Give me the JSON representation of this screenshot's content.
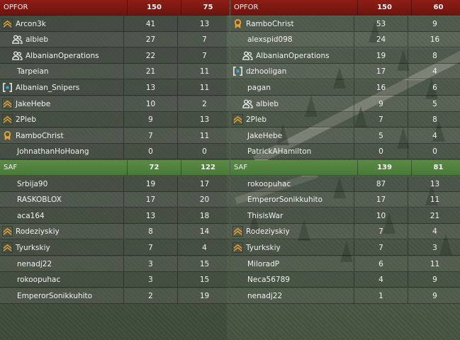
{
  "colors": {
    "opfor_header": "#7d1912",
    "saf_header": "#568640",
    "rank_orange": "#f0a030",
    "squad_blue": "#3aa8e8"
  },
  "left": {
    "opfor": {
      "team": "OPFOR",
      "a": "150",
      "b": "75"
    },
    "opfor_players": [
      {
        "icon": "rank-chevron-icon",
        "name": "Arcon3k",
        "a": "41",
        "b": "13"
      },
      {
        "icon": "friends-icon",
        "name": "albieb",
        "a": "27",
        "b": "7"
      },
      {
        "icon": "friends-icon",
        "name": "AlbanianOperations",
        "a": "22",
        "b": "7"
      },
      {
        "icon": "",
        "name": "Tarpeian",
        "a": "21",
        "b": "11"
      },
      {
        "icon": "squad-bracket-icon",
        "name": "Albanian_Snipers",
        "a": "13",
        "b": "11"
      },
      {
        "icon": "rank-chevron-icon",
        "name": "JakeHebe",
        "a": "10",
        "b": "2"
      },
      {
        "icon": "rank-chevron-icon",
        "name": "2Pleb",
        "a": "9",
        "b": "13"
      },
      {
        "icon": "rank-medal-icon",
        "name": "RamboChrist",
        "a": "7",
        "b": "11"
      },
      {
        "icon": "",
        "name": "JohnathanHoHoang",
        "a": "0",
        "b": "0"
      }
    ],
    "saf": {
      "team": "SAF",
      "a": "72",
      "b": "122"
    },
    "saf_players": [
      {
        "icon": "",
        "name": "Srbija90",
        "a": "19",
        "b": "17"
      },
      {
        "icon": "",
        "name": "RASKOBLOX",
        "a": "17",
        "b": "20"
      },
      {
        "icon": "",
        "name": "aca164",
        "a": "13",
        "b": "18"
      },
      {
        "icon": "rank-chevron-icon",
        "name": "Rodeziyskiy",
        "a": "8",
        "b": "14"
      },
      {
        "icon": "rank-chevron-icon",
        "name": "Tyurkskiy",
        "a": "7",
        "b": "4"
      },
      {
        "icon": "",
        "name": "nenadj22",
        "a": "3",
        "b": "15"
      },
      {
        "icon": "",
        "name": "rokoopuhac",
        "a": "3",
        "b": "15"
      },
      {
        "icon": "",
        "name": "EmperorSonikkuhito",
        "a": "2",
        "b": "19"
      }
    ]
  },
  "right": {
    "opfor": {
      "team": "OPFOR",
      "a": "150",
      "b": "60"
    },
    "opfor_players": [
      {
        "icon": "rank-medal-icon",
        "name": "RamboChrist",
        "a": "53",
        "b": "9"
      },
      {
        "icon": "",
        "name": "alexspid098",
        "a": "24",
        "b": "16"
      },
      {
        "icon": "friends-icon",
        "name": "AlbanianOperations",
        "a": "19",
        "b": "8"
      },
      {
        "icon": "squad-bracket-icon",
        "name": "dzhooligan",
        "a": "17",
        "b": "4"
      },
      {
        "icon": "",
        "name": "pagan",
        "a": "16",
        "b": "6"
      },
      {
        "icon": "friends-icon",
        "name": "albieb",
        "a": "9",
        "b": "5"
      },
      {
        "icon": "rank-chevron-icon",
        "name": "2Pleb",
        "a": "7",
        "b": "8"
      },
      {
        "icon": "",
        "name": "JakeHebe",
        "a": "5",
        "b": "4"
      },
      {
        "icon": "",
        "name": "PatrickAHamilton",
        "a": "0",
        "b": "0"
      }
    ],
    "saf": {
      "team": "SAF",
      "a": "139",
      "b": "81"
    },
    "saf_players": [
      {
        "icon": "",
        "name": "rokoopuhac",
        "a": "87",
        "b": "13"
      },
      {
        "icon": "",
        "name": "EmperorSonikkuhito",
        "a": "17",
        "b": "11"
      },
      {
        "icon": "",
        "name": "ThislsWar",
        "a": "10",
        "b": "21"
      },
      {
        "icon": "rank-chevron-icon",
        "name": "Rodeziyskiy",
        "a": "7",
        "b": "4"
      },
      {
        "icon": "rank-chevron-icon",
        "name": "Tyurkskiy",
        "a": "7",
        "b": "3"
      },
      {
        "icon": "",
        "name": "MiloradP",
        "a": "6",
        "b": "11"
      },
      {
        "icon": "",
        "name": "Neca56789",
        "a": "4",
        "b": "9"
      },
      {
        "icon": "",
        "name": "nenadj22",
        "a": "1",
        "b": "9"
      }
    ]
  }
}
